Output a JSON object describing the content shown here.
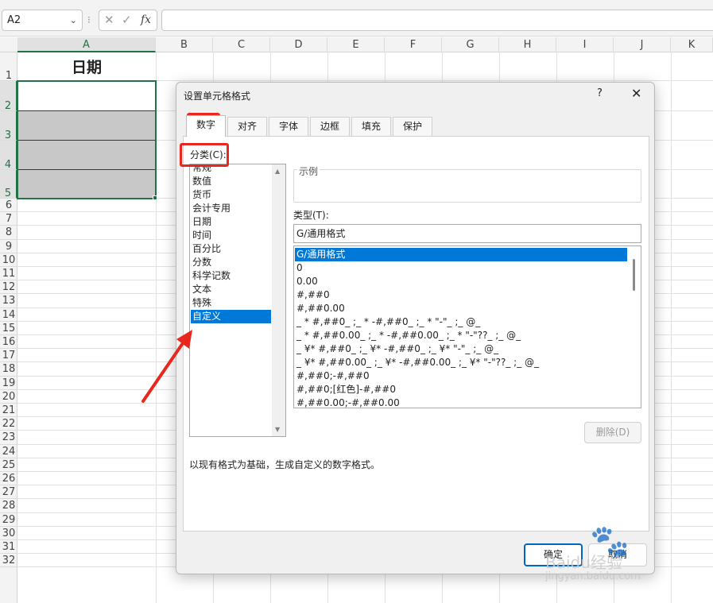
{
  "formula_bar": {
    "name_box": "A2",
    "fx": "fx",
    "separator": "⁝",
    "cancel_glyph": "✕",
    "enter_glyph": "✓",
    "dropdown_icon": "chevron-down-icon"
  },
  "sheet": {
    "columns": [
      "A",
      "B",
      "C",
      "D",
      "E",
      "F",
      "G",
      "H",
      "I",
      "J",
      "K"
    ],
    "rows": [
      "1",
      "2",
      "3",
      "4",
      "5",
      "6",
      "7",
      "8",
      "9",
      "10",
      "11",
      "12",
      "13",
      "14",
      "15",
      "16",
      "17",
      "18",
      "19",
      "20",
      "21",
      "22",
      "23",
      "24",
      "25",
      "26",
      "27",
      "28",
      "29",
      "30",
      "31",
      "32"
    ],
    "cell_a1": "日期",
    "selection_color": "#217346",
    "filled_cell_color": "#c8c8c8"
  },
  "dialog": {
    "title": "设置单元格格式",
    "help": "?",
    "close": "✕",
    "tabs": [
      "数字",
      "对齐",
      "字体",
      "边框",
      "填充",
      "保护"
    ],
    "active_tab": "数字",
    "category_label": "分类(C):",
    "categories": [
      "常规",
      "数值",
      "货币",
      "会计专用",
      "日期",
      "时间",
      "百分比",
      "分数",
      "科学记数",
      "文本",
      "特殊",
      "自定义"
    ],
    "selected_category": "自定义",
    "sample_label": "示例",
    "type_label": "类型(T):",
    "type_value": "G/通用格式",
    "formats": [
      "G/通用格式",
      "0",
      "0.00",
      "#,##0",
      "#,##0.00",
      "_ * #,##0_ ;_ * -#,##0_ ;_ * \"-\"_ ;_ @_ ",
      "_ * #,##0.00_ ;_ * -#,##0.00_ ;_ * \"-\"??_ ;_ @_ ",
      "_ ¥* #,##0_ ;_ ¥* -#,##0_ ;_ ¥* \"-\"_ ;_ @_ ",
      "_ ¥* #,##0.00_ ;_ ¥* -#,##0.00_ ;_ ¥* \"-\"??_ ;_ @_ ",
      "#,##0;-#,##0",
      "#,##0;[红色]-#,##0",
      "#,##0.00;-#,##0.00"
    ],
    "selected_format": "G/通用格式",
    "delete_button": "删除(D)",
    "description": "以现有格式为基础，生成自定义的数字格式。",
    "ok_button": "确定",
    "cancel_button": "取消",
    "selection_color": "#0078d7"
  },
  "annotations": {
    "highlight_color": "#e8281e"
  },
  "watermark": {
    "brand": "Baidu经验",
    "url": "jingyan.baidu.com"
  }
}
